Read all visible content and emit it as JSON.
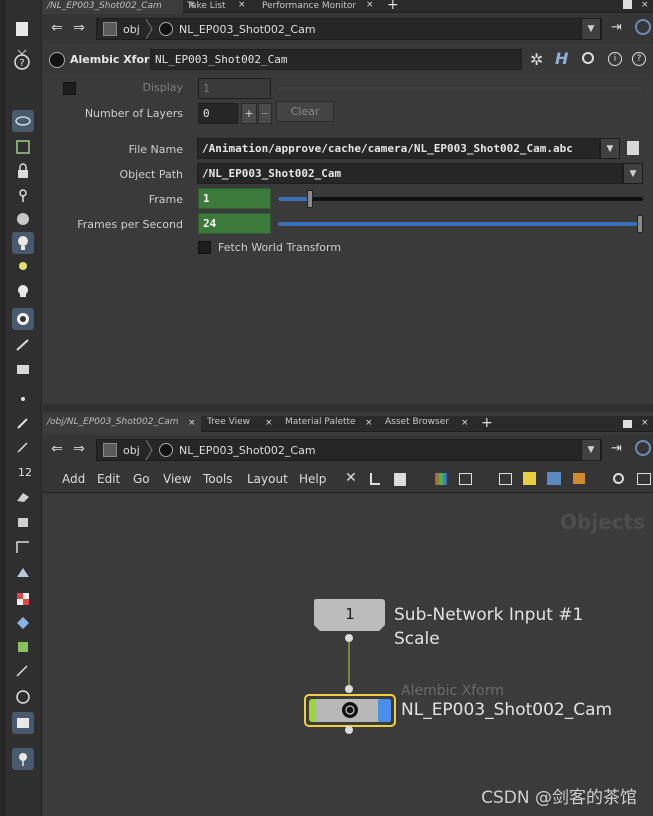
{
  "top_tabs": [
    {
      "label": "/NL_EP003_Shot002_Cam",
      "active": true
    },
    {
      "label": "Take List",
      "active": false
    },
    {
      "label": "Performance Monitor",
      "active": false
    }
  ],
  "top_path": {
    "root": "obj",
    "node": "NL_EP003_Shot002_Cam"
  },
  "param_header": {
    "type": "Alembic Xform",
    "name": "NL_EP003_Shot002_Cam"
  },
  "params": {
    "display_label": "Display",
    "display_value": "1",
    "layers_label": "Number of Layers",
    "layers_value": "0",
    "plus": "+",
    "minus": "−",
    "clear_label": "Clear",
    "file_label": "File Name",
    "file_value": "/Animation/approve/cache/camera/NL_EP003_Shot002_Cam.abc",
    "objpath_label": "Object Path",
    "objpath_value": "/NL_EP003_Shot002_Cam",
    "frame_label": "Frame",
    "frame_value": "1",
    "frame_slider": 0.08,
    "fps_label": "Frames per Second",
    "fps_value": "24",
    "fps_slider": 1.0,
    "fetch_label": "Fetch World Transform"
  },
  "bottom_tabs": [
    {
      "label": "/obj/NL_EP003_Shot002_Cam",
      "active": true
    },
    {
      "label": "Tree View",
      "active": false
    },
    {
      "label": "Material Palette",
      "active": false
    },
    {
      "label": "Asset Browser",
      "active": false
    }
  ],
  "bottom_path": {
    "root": "obj",
    "node": "NL_EP003_Shot002_Cam"
  },
  "menus": [
    "Add",
    "Edit",
    "Go",
    "View",
    "Tools",
    "Layout",
    "Help"
  ],
  "network": {
    "context_label": "Objects",
    "input_node": {
      "number": "1",
      "label1": "Sub-Network Input #1",
      "label2": "Scale"
    },
    "xform_node": {
      "type_label": "Alembic Xform",
      "name": "NL_EP003_Shot002_Cam"
    }
  },
  "watermark": "CSDN @剑客的茶馆",
  "colors": {
    "accent_blue": "#3d6fb6",
    "green_field": "#3c7a3c",
    "node_green": "#9bd634",
    "node_blue": "#4a90e8",
    "node_selected": "#f0d040"
  }
}
